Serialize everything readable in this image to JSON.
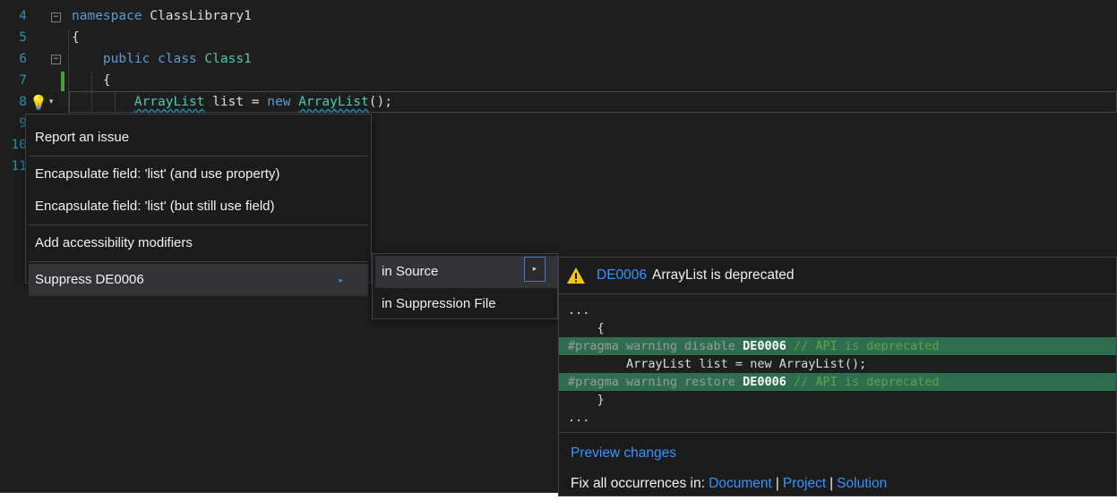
{
  "editor": {
    "lines": [
      {
        "num": "4",
        "segments": [
          {
            "t": "namespace",
            "c": "kw"
          },
          {
            "t": " ClassLibrary1",
            "c": ""
          }
        ]
      },
      {
        "num": "5",
        "segments": [
          {
            "t": "{",
            "c": ""
          }
        ]
      },
      {
        "num": "6",
        "segments": [
          {
            "t": "    public class ",
            "c": "kw"
          },
          {
            "t": "Class1",
            "c": "type"
          }
        ]
      },
      {
        "num": "7",
        "segments": [
          {
            "t": "    {",
            "c": ""
          }
        ]
      },
      {
        "num": "8",
        "segments": [
          {
            "t": "        ",
            "c": ""
          },
          {
            "t": "ArrayList",
            "c": "type squiggle"
          },
          {
            "t": " list = ",
            "c": ""
          },
          {
            "t": "new",
            "c": "kw"
          },
          {
            "t": " ",
            "c": ""
          },
          {
            "t": "ArrayList",
            "c": "type squiggle"
          },
          {
            "t": "();",
            "c": ""
          }
        ]
      },
      {
        "num": "9",
        "segments": []
      },
      {
        "num": "10",
        "segments": []
      },
      {
        "num": "11",
        "segments": []
      }
    ]
  },
  "lightbulb": {
    "icon": "lightbulb-icon",
    "glyph": "💡",
    "caret": "▾"
  },
  "quick_actions": {
    "report": "Report an issue",
    "encapsulate_property": "Encapsulate field: 'list' (and use property)",
    "encapsulate_field": "Encapsulate field: 'list' (but still use field)",
    "add_modifiers": "Add accessibility modifiers",
    "suppress": "Suppress DE0006",
    "submenu_arrow": "▸"
  },
  "suppress_submenu": {
    "in_source": "in Source",
    "in_suppression_file": "in Suppression File",
    "arrow": "▸"
  },
  "preview": {
    "warning_icon": "warning-triangle-icon",
    "diagnostic_id": "DE0006",
    "diagnostic_message": "ArrayList is deprecated",
    "code_lines": [
      {
        "type": "context",
        "text": "..."
      },
      {
        "type": "context",
        "text": "    {"
      },
      {
        "type": "added",
        "pragma": "#pragma warning disable ",
        "id": "DE0006",
        "comment": " // API is deprecated"
      },
      {
        "type": "context",
        "text": "        ArrayList list = new ArrayList();"
      },
      {
        "type": "added",
        "pragma": "#pragma warning restore ",
        "id": "DE0006",
        "comment": " // API is deprecated"
      },
      {
        "type": "context",
        "text": "    }"
      },
      {
        "type": "context",
        "text": "..."
      }
    ],
    "preview_changes": "Preview changes",
    "fix_all_label": "Fix all occurrences in: ",
    "scope_document": "Document",
    "scope_project": "Project",
    "scope_solution": "Solution",
    "separator": "|"
  },
  "colors": {
    "editor_bg": "#1e1e1e",
    "menu_bg": "#1b1b1c",
    "link": "#3794ff",
    "added_line": "#2e6e4e",
    "warning": "#f5c518"
  }
}
